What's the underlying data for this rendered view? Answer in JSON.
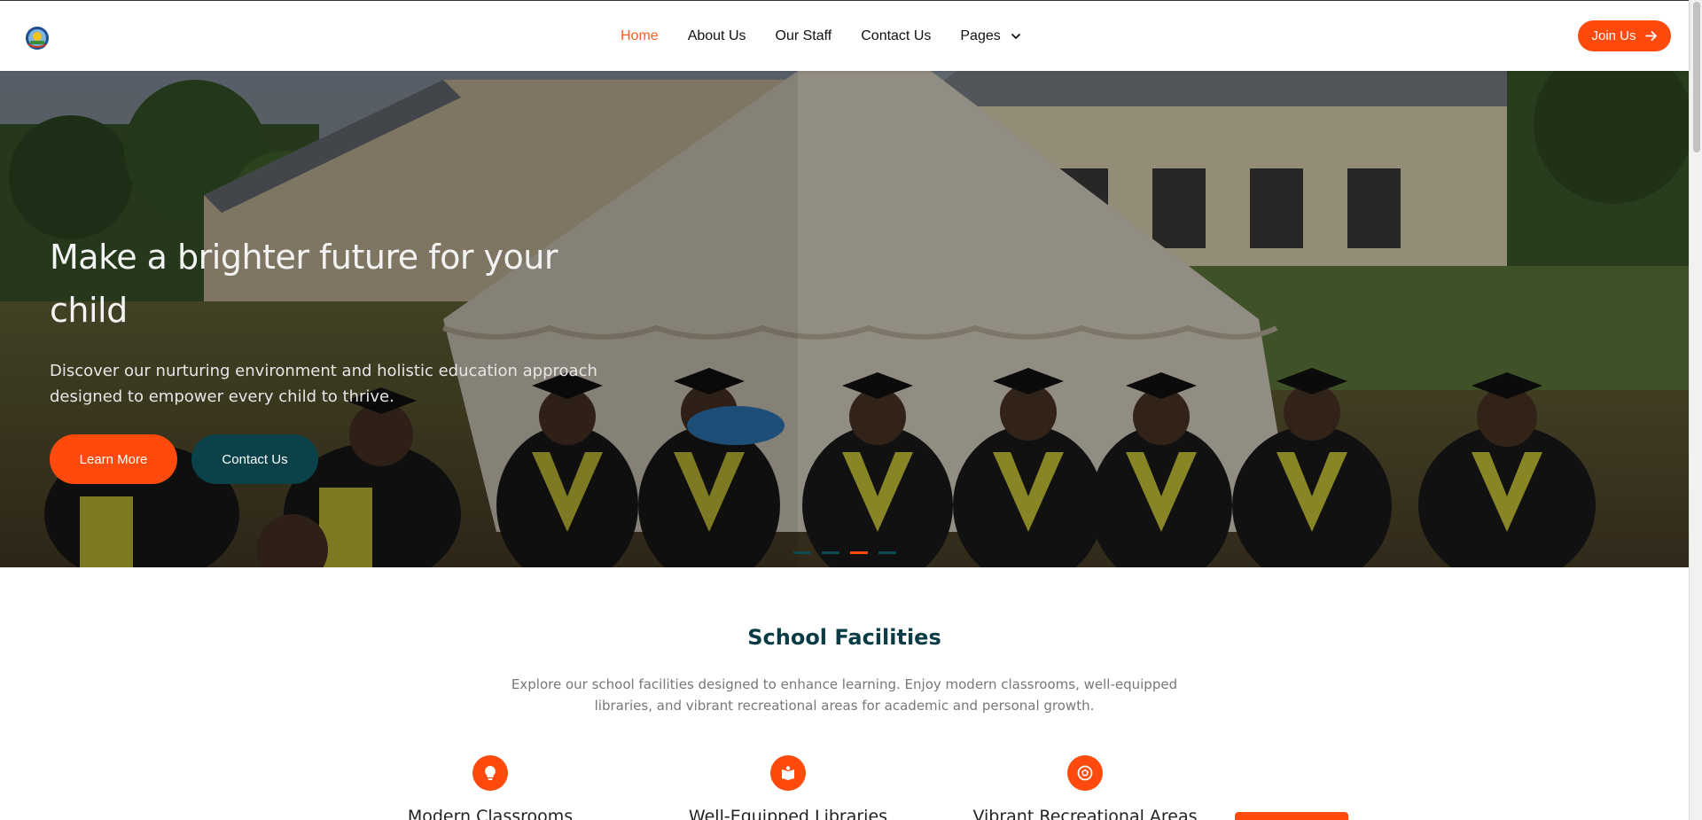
{
  "nav": {
    "logo_label": "",
    "links": [
      {
        "label": "Home",
        "active": true
      },
      {
        "label": "About Us",
        "active": false
      },
      {
        "label": "Our Staff",
        "active": false
      },
      {
        "label": "Contact Us",
        "active": false
      }
    ],
    "pages_label": "Pages",
    "join_label": "Join Us"
  },
  "hero": {
    "title": "Make a brighter future for your child",
    "subtitle": "Discover our nurturing environment and holistic education approach designed to empower every child to thrive.",
    "primary_button": "Learn More",
    "secondary_button": "Contact Us",
    "slides": 4,
    "active_slide": 3
  },
  "facilities": {
    "title": "School Facilities",
    "description": "Explore our school facilities designed to enhance learning. Enjoy modern classrooms, well-equipped libraries, and vibrant recreational areas for academic and personal growth.",
    "items": [
      {
        "label": "Modern Classrooms",
        "icon": "lightbulb-icon"
      },
      {
        "label": "Well-Equipped Libraries",
        "icon": "book-icon"
      },
      {
        "label": "Vibrant Recreational Areas",
        "icon": "soccer-ball-icon"
      }
    ]
  },
  "colors": {
    "accent": "#fe4a0c",
    "dark_teal": "#0b4148",
    "title_teal": "#0b3c45"
  }
}
